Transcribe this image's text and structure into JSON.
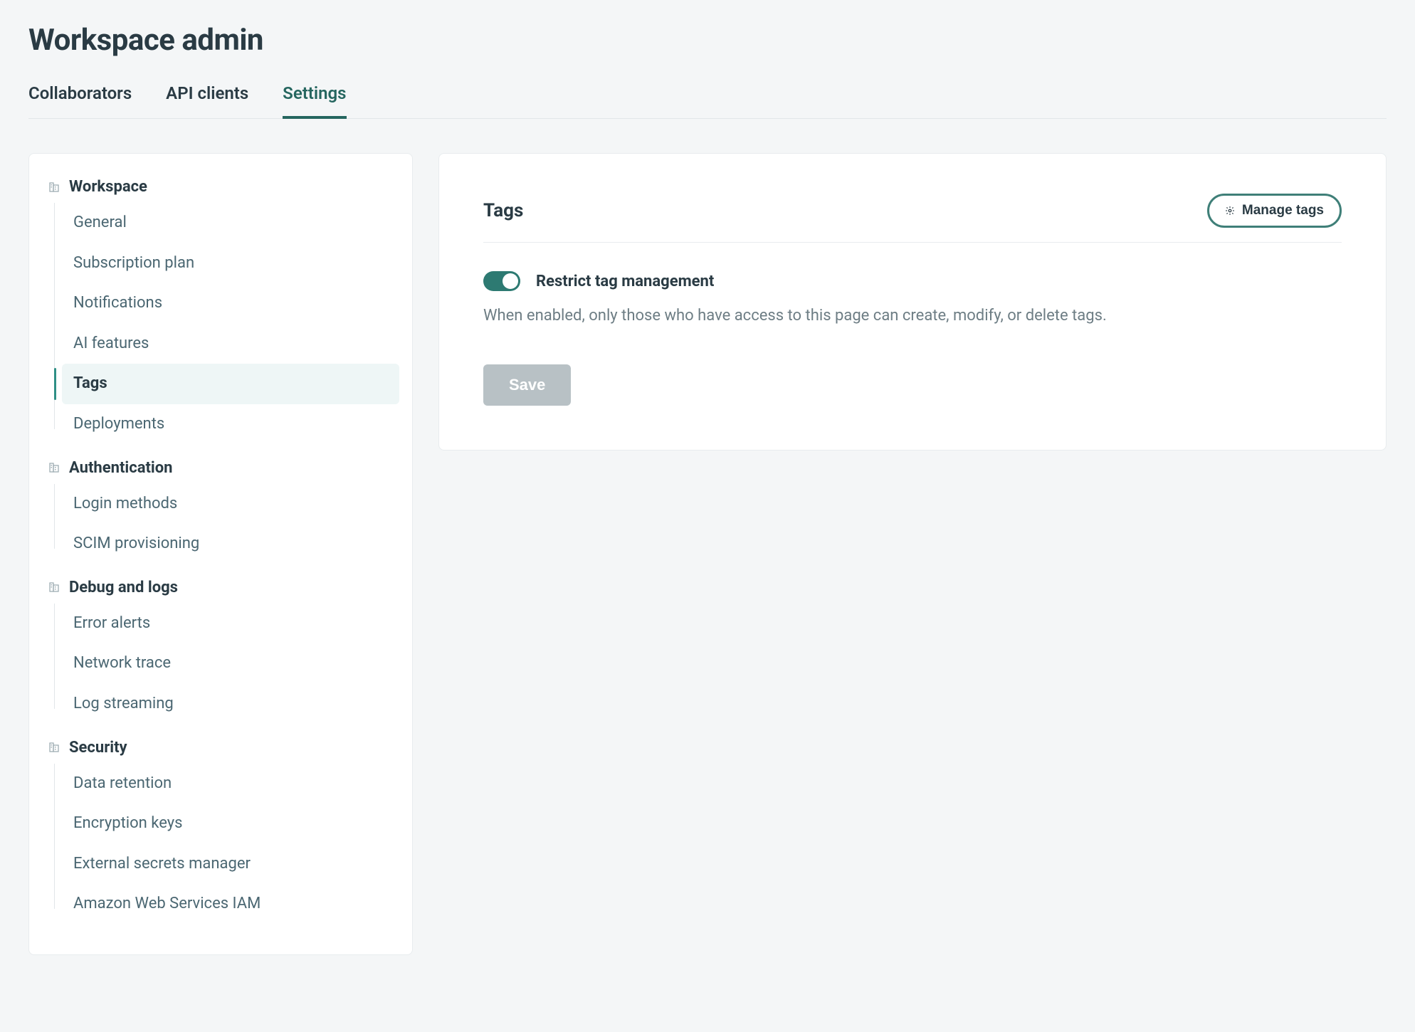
{
  "page": {
    "title": "Workspace admin"
  },
  "tabs": [
    {
      "label": "Collaborators",
      "active": false
    },
    {
      "label": "API clients",
      "active": false
    },
    {
      "label": "Settings",
      "active": true
    }
  ],
  "sidebar": [
    {
      "title": "Workspace",
      "items": [
        {
          "label": "General",
          "active": false
        },
        {
          "label": "Subscription plan",
          "active": false
        },
        {
          "label": "Notifications",
          "active": false
        },
        {
          "label": "AI features",
          "active": false
        },
        {
          "label": "Tags",
          "active": true
        },
        {
          "label": "Deployments",
          "active": false
        }
      ]
    },
    {
      "title": "Authentication",
      "items": [
        {
          "label": "Login methods",
          "active": false
        },
        {
          "label": "SCIM provisioning",
          "active": false
        }
      ]
    },
    {
      "title": "Debug and logs",
      "items": [
        {
          "label": "Error alerts",
          "active": false
        },
        {
          "label": "Network trace",
          "active": false
        },
        {
          "label": "Log streaming",
          "active": false
        }
      ]
    },
    {
      "title": "Security",
      "items": [
        {
          "label": "Data retention",
          "active": false
        },
        {
          "label": "Encryption keys",
          "active": false
        },
        {
          "label": "External secrets manager",
          "active": false
        },
        {
          "label": "Amazon Web Services IAM",
          "active": false
        }
      ]
    }
  ],
  "main": {
    "title": "Tags",
    "manage_button": "Manage tags",
    "toggle": {
      "label": "Restrict tag management",
      "enabled": true,
      "description": "When enabled, only those who have access to this page can create, modify, or delete tags."
    },
    "save_button": "Save",
    "save_enabled": false
  }
}
